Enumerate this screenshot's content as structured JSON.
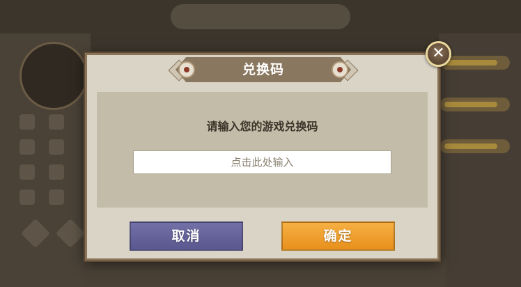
{
  "dialog": {
    "title": "兑换码",
    "prompt": "请输入您的游戏兑换码",
    "input": {
      "value": "",
      "placeholder": "点击此处输入"
    },
    "cancel_label": "取消",
    "confirm_label": "确定",
    "close_symbol": "✕"
  },
  "colors": {
    "cancel_button": "#6a679e",
    "confirm_button": "#f0a030",
    "dialog_background": "#d9d4c6",
    "title_ribbon": "#8a775f"
  },
  "icons": {
    "close": "close-icon",
    "title_ornament": "medal-icon"
  }
}
